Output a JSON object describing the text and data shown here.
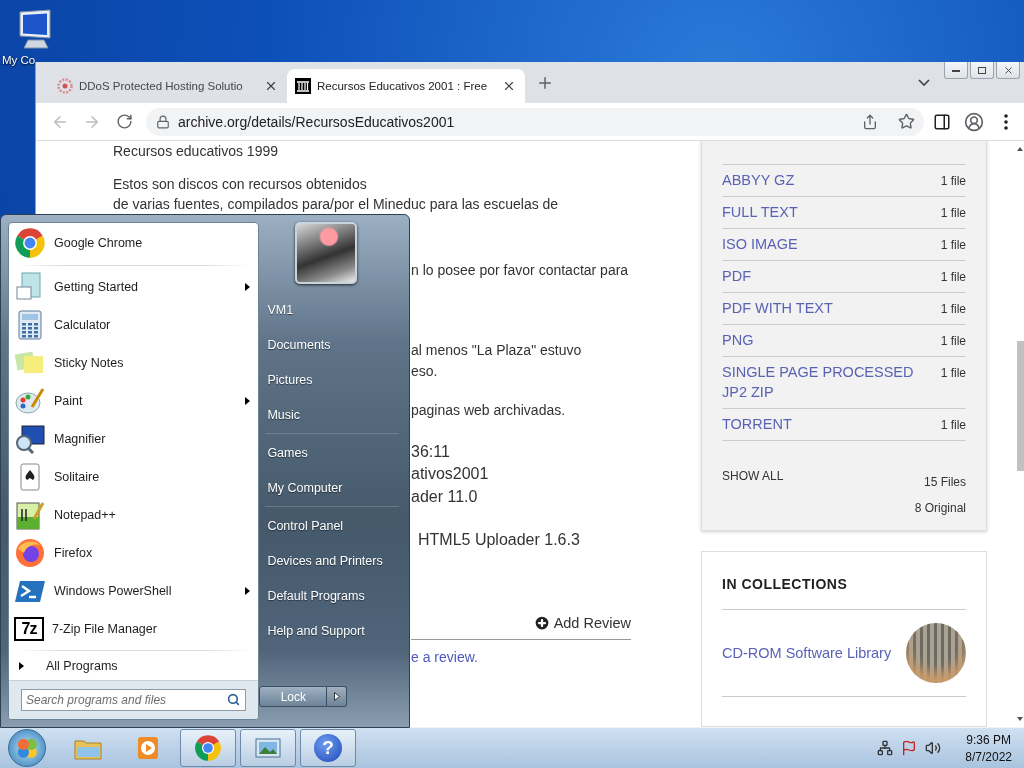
{
  "desktop": {
    "icons": [
      {
        "label": "My Co",
        "kind": "computer"
      }
    ]
  },
  "browser": {
    "tabs": [
      {
        "title": "DDoS Protected Hosting Solutio",
        "selected": false,
        "kind": "gear"
      },
      {
        "title": "Recursos Educativos 2001 : Free",
        "selected": true,
        "kind": "museum"
      }
    ],
    "url": "archive.org/details/RecursosEducativos2001"
  },
  "page": {
    "paragraphs": [
      [
        "Recursos educativos 1999"
      ],
      [
        "Estos son discos con recursos obtenidos",
        "de varias fuentes, compilados para/por el Mineduc para las escuelas de"
      ],
      [
        "n lo posee por favor contactar para"
      ],
      [
        "al menos \"La Plaza\" estuvo",
        "eso."
      ],
      [
        "paginas web archivadas."
      ]
    ],
    "details": [
      "36:11",
      "ativos2001",
      "ader 11.0"
    ],
    "uploader": "HTML5 Uploader 1.6.3",
    "add_review": "Add Review",
    "review_link": "e a review."
  },
  "downloads": {
    "rows": [
      {
        "format": "ABBYY GZ",
        "count": "1 file"
      },
      {
        "format": "FULL TEXT",
        "count": "1 file"
      },
      {
        "format": "ISO IMAGE",
        "count": "1 file"
      },
      {
        "format": "PDF",
        "count": "1 file"
      },
      {
        "format": "PDF WITH TEXT",
        "count": "1 file"
      },
      {
        "format": "PNG",
        "count": "1 file"
      },
      {
        "format": "SINGLE PAGE PROCESSED JP2 ZIP",
        "count": "1 file"
      },
      {
        "format": "TORRENT",
        "count": "1 file"
      }
    ],
    "show_all": "SHOW ALL",
    "files": "15 Files",
    "original": "8 Original"
  },
  "collections": {
    "title": "IN COLLECTIONS",
    "items": [
      {
        "name": "CD-ROM Software Library"
      }
    ]
  },
  "start_menu": {
    "pinned": [
      {
        "name": "Google Chrome",
        "kind": "chrome",
        "submenu": false
      }
    ],
    "recent": [
      {
        "name": "Getting Started",
        "kind": "getting-started",
        "submenu": true
      },
      {
        "name": "Calculator",
        "kind": "calculator",
        "submenu": false
      },
      {
        "name": "Sticky Notes",
        "kind": "sticky-notes",
        "submenu": false
      },
      {
        "name": "Paint",
        "kind": "paint",
        "submenu": true
      },
      {
        "name": "Magnifier",
        "kind": "magnifier",
        "submenu": false
      },
      {
        "name": "Solitaire",
        "kind": "solitaire",
        "submenu": false
      },
      {
        "name": "Notepad++",
        "kind": "notepad",
        "submenu": false
      },
      {
        "name": "Firefox",
        "kind": "firefox",
        "submenu": false
      },
      {
        "name": "Windows PowerShell",
        "kind": "powershell",
        "submenu": true
      },
      {
        "name": "7-Zip File Manager",
        "kind": "archive",
        "submenu": false,
        "badge": "7z"
      }
    ],
    "all_programs": "All Programs",
    "search_placeholder": "Search programs and files",
    "places": [
      [
        {
          "label": "VM1"
        },
        {
          "label": "Documents"
        },
        {
          "label": "Pictures"
        },
        {
          "label": "Music"
        }
      ],
      [
        {
          "label": "Games"
        },
        {
          "label": "My Computer"
        }
      ],
      [
        {
          "label": "Control Panel"
        },
        {
          "label": "Devices and Printers"
        },
        {
          "label": "Default Programs"
        },
        {
          "label": "Help and Support"
        }
      ]
    ],
    "lock": "Lock"
  },
  "taskbar": {
    "buttons": [
      {
        "kind": "explorer",
        "running": false
      },
      {
        "kind": "media",
        "running": false
      },
      {
        "kind": "chrome",
        "running": true
      },
      {
        "kind": "pictures",
        "running": true
      },
      {
        "kind": "help",
        "running": true,
        "glyph": "?"
      }
    ],
    "time": "9:36 PM",
    "date": "8/7/2022"
  }
}
